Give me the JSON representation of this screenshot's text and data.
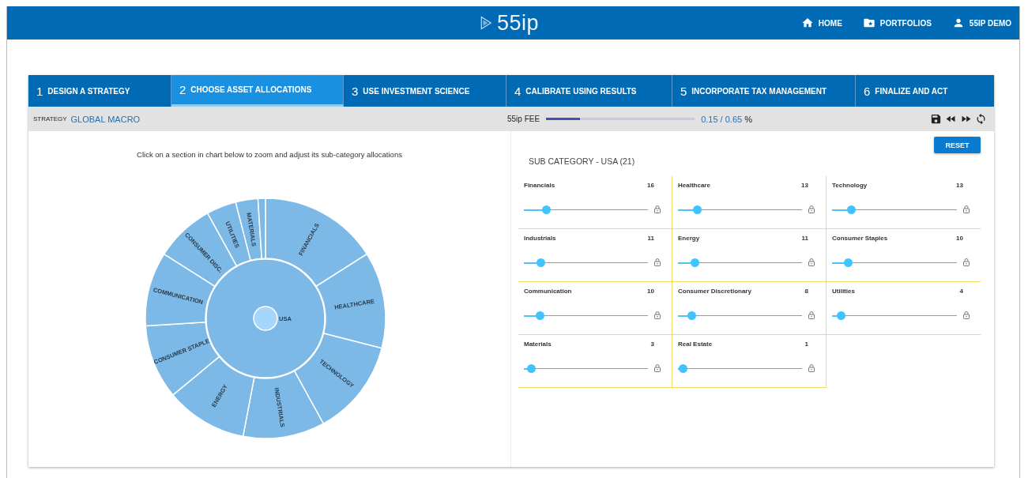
{
  "header": {
    "logo": "55ip",
    "nav": [
      {
        "kind": "home",
        "label": "HOME"
      },
      {
        "kind": "folder",
        "label": "PORTFOLIOS"
      },
      {
        "kind": "user",
        "label": "55IP DEMO"
      }
    ]
  },
  "steps": [
    {
      "number": "1",
      "label": "DESIGN A STRATEGY",
      "selected": false
    },
    {
      "number": "2",
      "label": "CHOOSE ASSET ALLOCATIONS",
      "selected": true
    },
    {
      "number": "3",
      "label": "USE INVESTMENT SCIENCE",
      "selected": false
    },
    {
      "number": "4",
      "label": "CALIBRATE USING RESULTS",
      "selected": false
    },
    {
      "number": "5",
      "label": "INCORPORATE TAX MANAGEMENT",
      "selected": false
    },
    {
      "number": "6",
      "label": "FINALIZE AND ACT",
      "selected": false
    }
  ],
  "toolbar": {
    "strategy_label": "STRATEGY",
    "strategy": "GLOBAL MACRO",
    "fee_label": "55ip FEE",
    "fee": {
      "level": 0.23
    },
    "fee_value": "0.15",
    "fee_separator": "/",
    "fee_max": "0.65",
    "fee_unit": "%",
    "actions": [
      {
        "kind": "save"
      },
      {
        "kind": "rewind"
      },
      {
        "kind": "forward"
      },
      {
        "kind": "sync"
      }
    ]
  },
  "chart": {
    "hint": "Click on a section in chart below to zoom and adjust its sub-category allocations",
    "center": "USA",
    "segments": [
      "FINANCIALS",
      "HEALTHCARE",
      "TECHNOLOGY",
      "INDUSTRIALS",
      "ENERGY",
      "CONSUMER STAPLE",
      "COMMUNICATION",
      "CONSUMER DISC.",
      "UTILITIES",
      "MATERIALS"
    ]
  },
  "subcategory": {
    "reset": "RESET",
    "title": "SUB CATEGORY - USA (21)",
    "sliders": [
      {
        "name": "Financials",
        "value": "16",
        "level": 0.16
      },
      {
        "name": "Healthcare",
        "value": "13",
        "level": 0.13
      },
      {
        "name": "Technology",
        "value": "13",
        "level": 0.13
      },
      {
        "name": "Industrials",
        "value": "11",
        "level": 0.11
      },
      {
        "name": "Energy",
        "value": "11",
        "level": 0.11
      },
      {
        "name": "Consumer Staples",
        "value": "10",
        "level": 0.1
      },
      {
        "name": "Communication",
        "value": "10",
        "level": 0.1
      },
      {
        "name": "Consumer Discretionary",
        "value": "8",
        "level": 0.08
      },
      {
        "name": "Utilities",
        "value": "4",
        "level": 0.04
      },
      {
        "name": "Materials",
        "value": "3",
        "level": 0.03
      },
      {
        "name": "Real Estate",
        "value": "1",
        "level": 0.01
      }
    ]
  }
}
